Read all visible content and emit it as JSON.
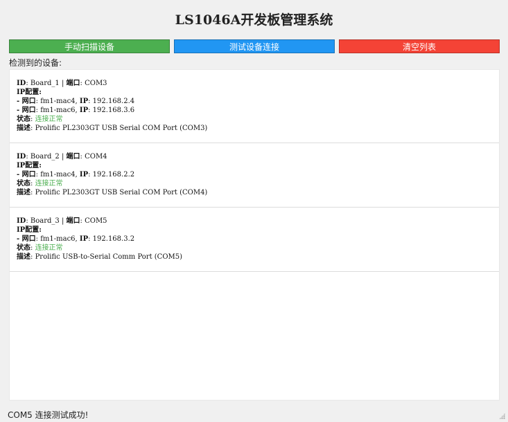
{
  "app": {
    "title": "LS1046A开发板管理系统"
  },
  "toolbar": {
    "scan_label": "手动扫描设备",
    "test_label": "测试设备连接",
    "clear_label": "清空列表",
    "colors": {
      "scan": "#4caf50",
      "test": "#2196f3",
      "clear": "#f44336"
    }
  },
  "list": {
    "label": "检测到的设备:",
    "ok_color": "#4caf50",
    "devices": [
      {
        "id_label": "ID",
        "id": "Board_1",
        "port_label": "端口",
        "port": "COM3",
        "ip_config_label": "IP配置:",
        "interfaces": [
          {
            "prefix": "- 网口",
            "iface": "fm1-mac4",
            "ip_label": "IP",
            "ip": "192.168.2.4"
          },
          {
            "prefix": "- 网口",
            "iface": "fm1-mac6",
            "ip_label": "IP",
            "ip": "192.168.3.6"
          }
        ],
        "status_label": "状态",
        "status": "连接正常",
        "desc_label": "描述",
        "desc": "Prolific PL2303GT USB Serial COM Port (COM3)"
      },
      {
        "id_label": "ID",
        "id": "Board_2",
        "port_label": "端口",
        "port": "COM4",
        "ip_config_label": "IP配置:",
        "interfaces": [
          {
            "prefix": "- 网口",
            "iface": "fm1-mac4",
            "ip_label": "IP",
            "ip": "192.168.2.2"
          }
        ],
        "status_label": "状态",
        "status": "连接正常",
        "desc_label": "描述",
        "desc": "Prolific PL2303GT USB Serial COM Port (COM4)"
      },
      {
        "id_label": "ID",
        "id": "Board_3",
        "port_label": "端口",
        "port": "COM5",
        "ip_config_label": "IP配置:",
        "interfaces": [
          {
            "prefix": "- 网口",
            "iface": "fm1-mac6",
            "ip_label": "IP",
            "ip": "192.168.3.2"
          }
        ],
        "status_label": "状态",
        "status": "连接正常",
        "desc_label": "描述",
        "desc": "Prolific USB-to-Serial Comm Port (COM5)"
      }
    ]
  },
  "statusbar": {
    "message": "COM5 连接测试成功!"
  }
}
